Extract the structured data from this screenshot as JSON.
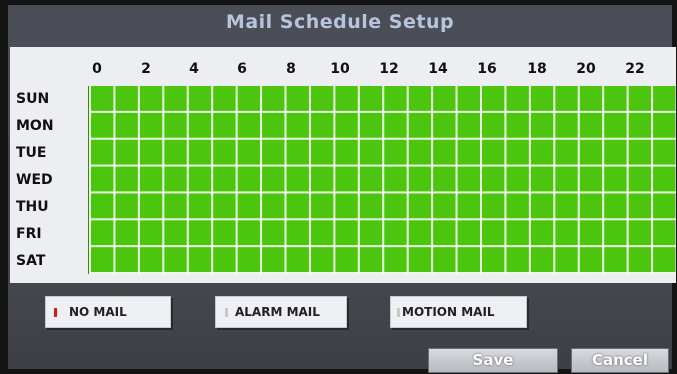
{
  "title": "Mail Schedule Setup",
  "hours": [
    "0",
    "2",
    "4",
    "6",
    "8",
    "10",
    "12",
    "14",
    "16",
    "18",
    "20",
    "22"
  ],
  "days": [
    "SUN",
    "MON",
    "TUE",
    "WED",
    "THU",
    "FRI",
    "SAT"
  ],
  "legend": {
    "no_mail": "NO MAIL",
    "alarm_mail": "ALARM MAIL",
    "motion_mail": "MOTION MAIL"
  },
  "buttons": {
    "save": "Save",
    "cancel": "Cancel"
  },
  "colors": {
    "schedule_fill": "#4bc50d",
    "no_mail": "#d11a1a",
    "alarm_mail": "#c8c8c8",
    "motion_mail": "#c8c8c8"
  }
}
